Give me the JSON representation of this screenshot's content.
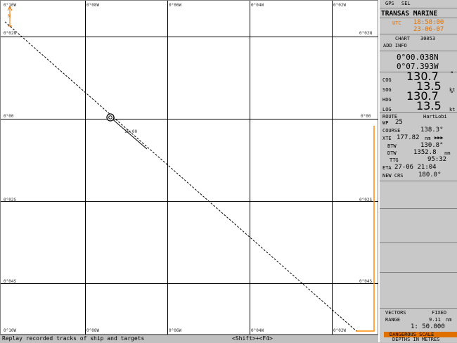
{
  "chart": {
    "grid_top": [
      "0°10W",
      "0°08W",
      "0°06W",
      "0°04W",
      "0°02W"
    ],
    "grid_bottom": [
      "0°10W",
      "0°08W",
      "0°06W",
      "0°04W",
      "0°02W"
    ],
    "grid_left": [
      "0°02N",
      "0°00",
      "0°02S",
      "0°04S"
    ],
    "grid_right": [
      "0°02N",
      "0°00",
      "0°02S",
      "0°04S"
    ],
    "time_label": "18:00",
    "north_label": "N",
    "colors": {
      "track": "#000000",
      "grid": "#000000",
      "route": "#ff8c00",
      "north": "#e07000"
    }
  },
  "panel": {
    "tabs": [
      "GPS",
      "SEL"
    ],
    "brand": "TRANSAS MARINE",
    "utc_label": "UTC",
    "time": "18:58:00",
    "date": "23-06-07",
    "chart_label": "CHART",
    "chart_no": "30053",
    "add_info": "ADD INFO",
    "lat": "0°00.038N",
    "lon": "0°07.393W",
    "cog_label": "COG",
    "cog_value": "130.7",
    "cog_unit": "°",
    "sog_label": "SOG",
    "sog_value": "13.5",
    "sog_unit": "kt",
    "hdg_label": "HDG",
    "hdg_value": "130.7",
    "hdg_unit": "°",
    "log_label": "LOG",
    "log_value": "13.5",
    "log_unit": "kt",
    "route_label": "ROUTE",
    "route_name": "HartLobi",
    "wp_label": "WP",
    "wp_value": "25",
    "course_label": "COURSE",
    "course_value": "138.3°",
    "xte_label": "XTE",
    "xte_value": "177.82",
    "xte_unit": "nm",
    "xte_arrows": "▶▶▶",
    "btw_label": "BTW",
    "btw_value": "130.8°",
    "dtw_label": "DTW",
    "dtw_value": "1352.8",
    "dtw_unit": "nm",
    "ttg_label": "TTG",
    "ttg_value": "95:32",
    "eta_label": "ETA",
    "eta_value": "27-06 21:04",
    "newcrs_label": "NEW CRS",
    "newcrs_value": "180.0°",
    "vectors_label": "VECTORS",
    "vectors_value": "FIXED",
    "range_label": "RANGE",
    "range_value": "9.11",
    "range_unit": "nm",
    "scale_value": "1: 50.000",
    "danger_label": "DANGEROUS SCALE",
    "depth_label": "DEPTHS IN METRES"
  },
  "status": {
    "message": "Replay recorded tracks of ship and targets",
    "shortcut": "<Shift>+<F4>"
  }
}
